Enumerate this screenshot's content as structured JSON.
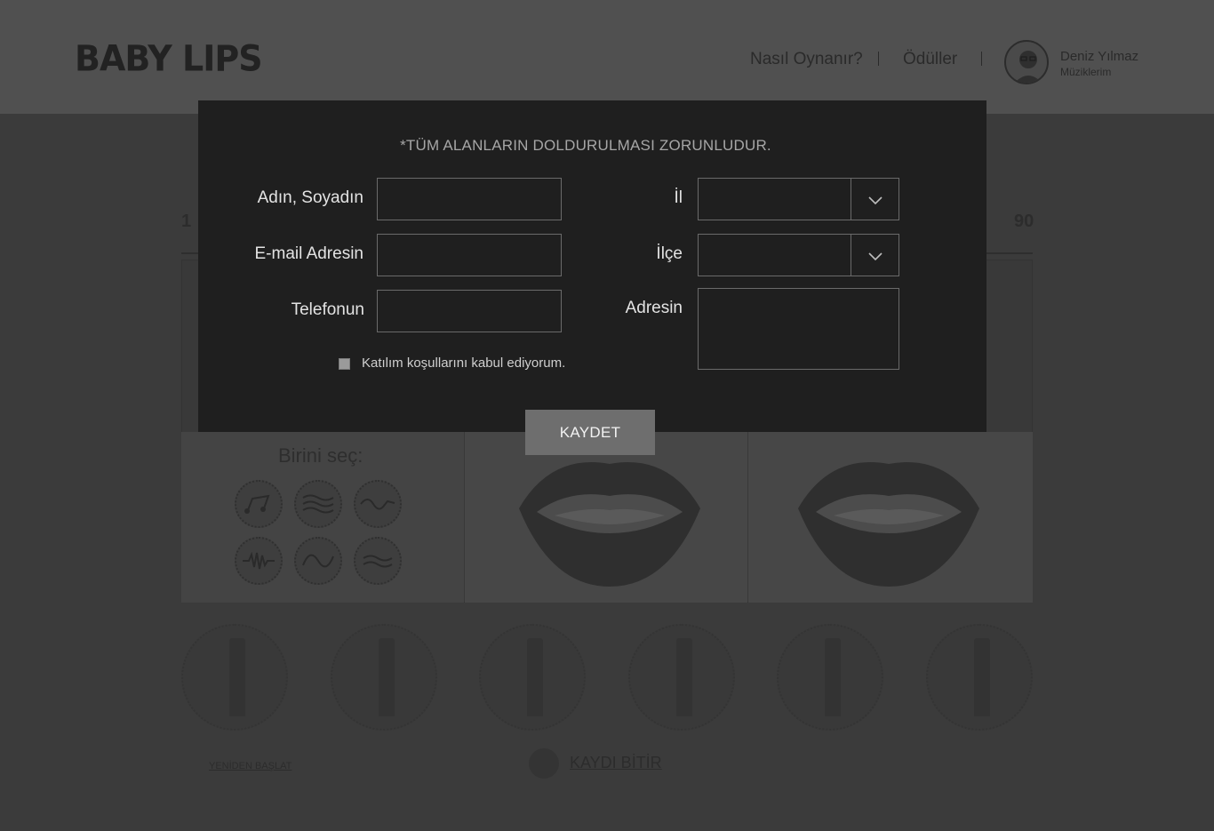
{
  "header": {
    "logo": "BABY LIPS",
    "nav": [
      "Nasıl Oynanır?",
      "Ödüller"
    ],
    "user": {
      "name": "Deniz Yılmaz",
      "subtitle": "Müziklerim"
    }
  },
  "background": {
    "scale_start": "1",
    "scale_end": "90",
    "choose_label": "Birini seç:",
    "sound_icons": [
      "notes-icon",
      "waves-icon",
      "sine-wave-icon",
      "pulse-wave-icon",
      "soft-wave-icon",
      "ripple-icon"
    ],
    "restart_link": "YENİDEN BAŞLAT",
    "finish_link": "KAYDI BİTİR"
  },
  "modal": {
    "required_note": "*TÜM ALANLARIN DOLDURULMASI ZORUNLUDUR.",
    "fields": {
      "name": {
        "label": "Adın, Soyadın",
        "value": ""
      },
      "email": {
        "label": "E-mail Adresin",
        "value": ""
      },
      "phone": {
        "label": "Telefonun",
        "value": ""
      },
      "city": {
        "label": "İl",
        "value": ""
      },
      "district": {
        "label": "İlçe",
        "value": ""
      },
      "address": {
        "label": "Adresin",
        "value": ""
      }
    },
    "terms_label": "Katılım koşullarını kabul ediyorum.",
    "terms_checked": false,
    "save_label": "KAYDET"
  },
  "colors": {
    "overlay_bg": "#3b3b3b",
    "modal_bg": "#1f1f1f",
    "button_bg": "#6e6e6e",
    "label_text": "#e3e3e3"
  }
}
